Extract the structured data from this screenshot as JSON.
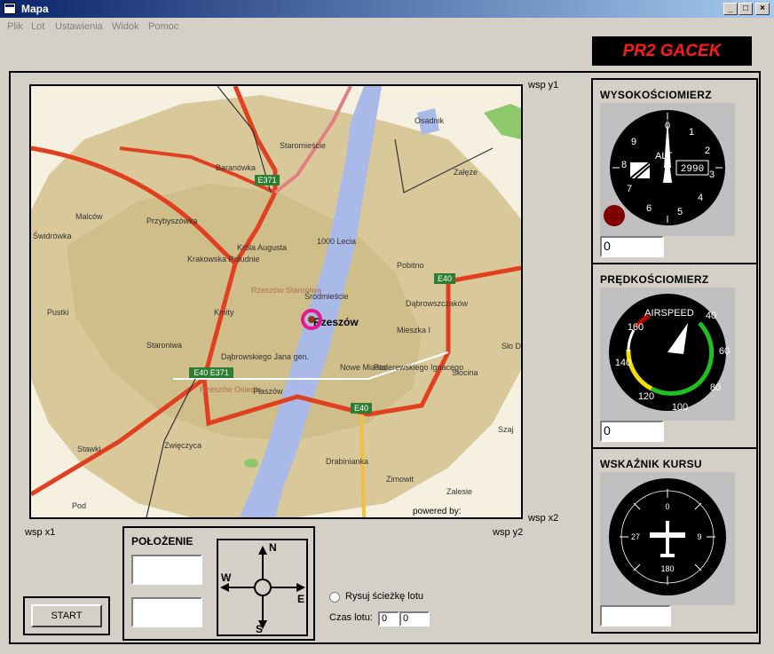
{
  "window": {
    "title": "Mapa"
  },
  "menu": [
    "Plik",
    "Lot",
    "Ustawienia",
    "Widok",
    "Pomoc"
  ],
  "brand": "PR2 GACEK",
  "map": {
    "corner_labels": {
      "y1": "wsp y1",
      "x2": "wsp x2",
      "x1": "wsp x1",
      "y2": "wsp y2"
    },
    "places": [
      "Osadnik",
      "Staromieście",
      "Załęże",
      "Baranówka",
      "E371",
      "Malców",
      "Przybyszówka",
      "Świdrówka",
      "Krakowska Południe",
      "Króla Augusta",
      "1000 Lecia",
      "Pobitno",
      "E40",
      "Pustki",
      "Rzeszów Staroniwa",
      "Śródmieście",
      "Rzeszów",
      "Dąbrowszczaków",
      "Kmity",
      "Mieszka I",
      "Staroniwa",
      "Dąbrowskiego Jana gen.",
      "Nowe Miasto",
      "Paderewskiego Ignacego",
      "Słocina",
      "Sło Doł",
      "E40 E371",
      "Rzeszów Osiedle",
      "Płaszów",
      "Szaj",
      "Stawki",
      "Zwięczyca",
      "Drabinianka",
      "Zimowit",
      "Zalesie",
      "Pod",
      "powered by:"
    ]
  },
  "gauges": {
    "altimeter": {
      "title": "WYSOKOŚCIOMIERZ",
      "dial_label": "ALT",
      "counter": "2990",
      "value": "0"
    },
    "airspeed": {
      "title": "PRĘDKOŚCIOMIERZ",
      "dial_label": "AIRSPEED",
      "value": "0"
    },
    "heading": {
      "title": "WSKAŹNIK KURSU",
      "value": ""
    }
  },
  "position": {
    "title": "POŁOŻENIE",
    "field1": "",
    "field2": "",
    "compass": {
      "n": "N",
      "s": "S",
      "e": "E",
      "w": "W"
    }
  },
  "controls": {
    "start_label": "START",
    "draw_path_label": "Rysuj ścieżkę lotu",
    "flight_time_label": "Czas lotu:",
    "time_value1": "0",
    "time_value2": "0"
  },
  "colors": {
    "brand_bg": "#000000",
    "brand_text": "#ff1a1a"
  }
}
